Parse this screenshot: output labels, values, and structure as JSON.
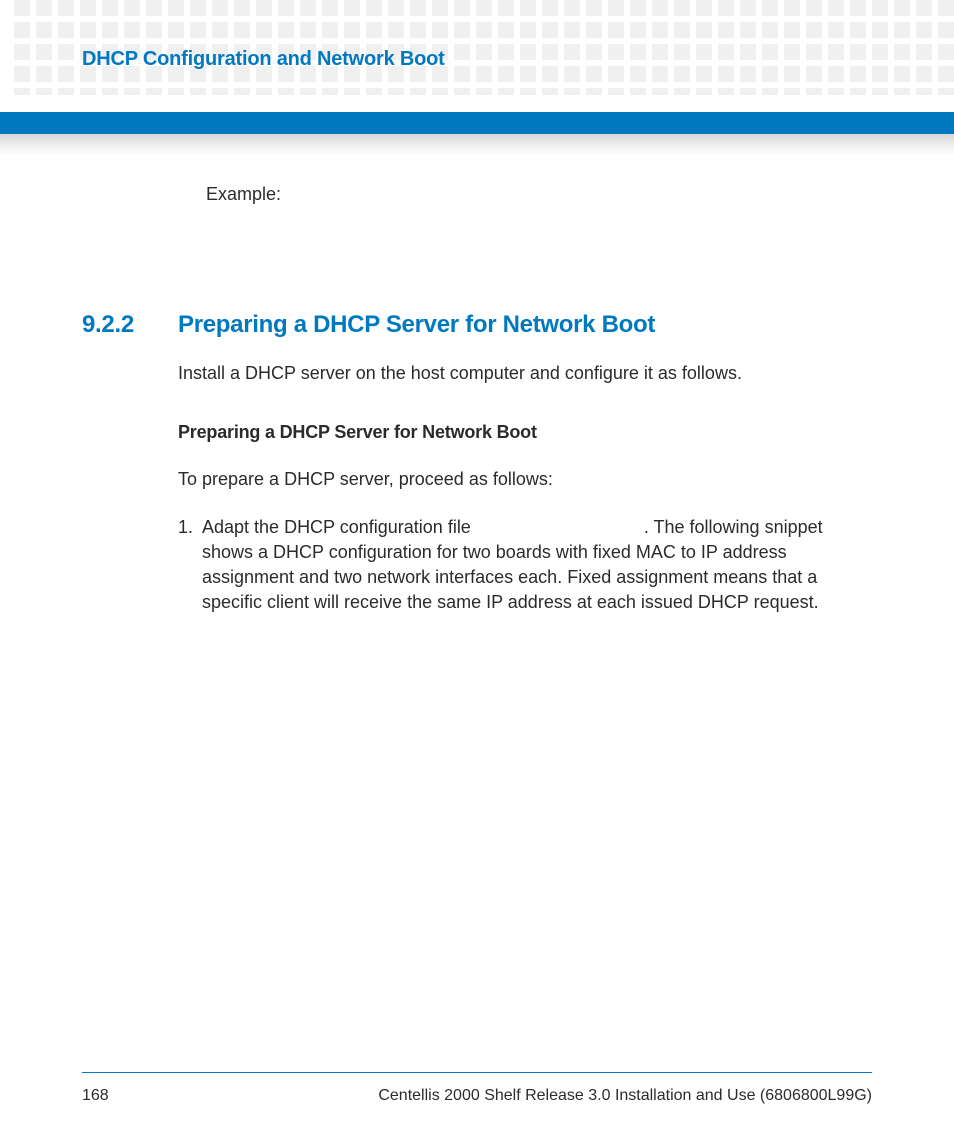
{
  "header": {
    "running_title": "DHCP Configuration and Network Boot"
  },
  "content": {
    "example_label": "Example:",
    "section_number": "9.2.2",
    "section_title": "Preparing a DHCP Server for Network Boot",
    "intro_para": "Install a DHCP server on the host computer and configure it as follows.",
    "subhead": "Preparing a DHCP Server for Network Boot",
    "prep_para": "To prepare a DHCP server, proceed as follows:",
    "step1_num": "1.",
    "step1_text_a": "Adapt the DHCP configuration file ",
    "step1_text_b": ". The following snippet shows a DHCP configuration for two boards with fixed MAC to IP address assignment and two network interfaces each. Fixed assignment means that a specific client will receive the same IP address at each issued DHCP request."
  },
  "footer": {
    "page_number": "168",
    "doc_title": "Centellis 2000 Shelf Release 3.0 Installation and Use (6806800L99G)"
  },
  "colors": {
    "accent": "#0079c1",
    "text": "#2b2b2b",
    "pattern": "#f0f0f0"
  }
}
